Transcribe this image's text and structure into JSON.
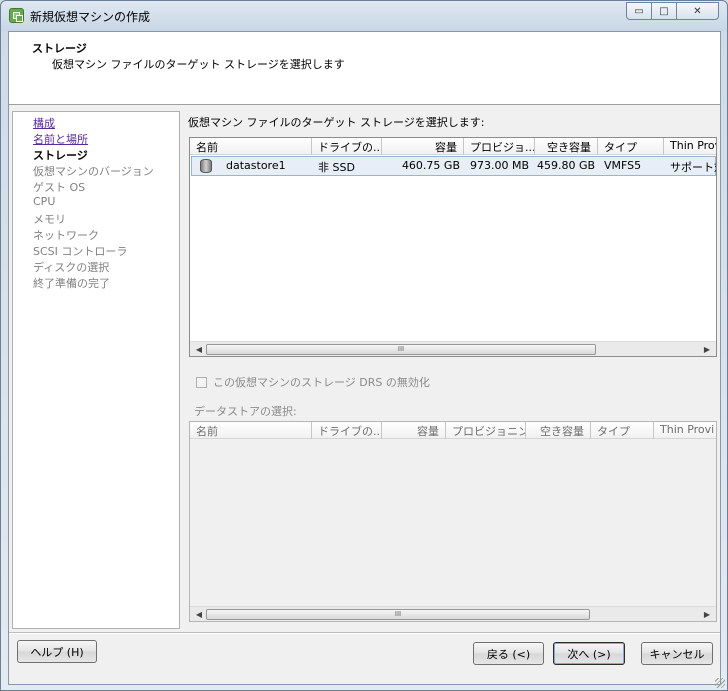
{
  "window": {
    "title": "新規仮想マシンの作成",
    "controls": {
      "minimize_glyph": "▭",
      "maximize_glyph": "□",
      "close_glyph": "✕"
    }
  },
  "header": {
    "title": "ストレージ",
    "subtitle": "仮想マシン ファイルのターゲット ストレージを選択します"
  },
  "nav": {
    "items": [
      {
        "label": "構成",
        "state": "link"
      },
      {
        "label": "名前と場所",
        "state": "link"
      },
      {
        "label": "ストレージ",
        "state": "current"
      },
      {
        "label": "仮想マシンのバージョン",
        "state": "disabled"
      },
      {
        "label": "ゲスト OS",
        "state": "disabled"
      },
      {
        "label": "CPU",
        "state": "disabled"
      },
      {
        "label": "メモリ",
        "state": "disabled"
      },
      {
        "label": "ネットワーク",
        "state": "disabled"
      },
      {
        "label": "SCSI コントローラ",
        "state": "disabled"
      },
      {
        "label": "ディスクの選択",
        "state": "disabled"
      },
      {
        "label": "終了準備の完了",
        "state": "disabled"
      }
    ]
  },
  "content": {
    "prompt": "仮想マシン ファイルのターゲット ストレージを選択します:",
    "datastore_table": {
      "columns": [
        "名前",
        "ドライブの...",
        "容量",
        "プロビジョ...",
        "空き容量",
        "タイプ",
        "Thin Prov"
      ],
      "rows": [
        {
          "icon": "datastore-icon",
          "name": "datastore1",
          "drive": "非 SSD",
          "capacity": "460.75 GB",
          "provisioned": "973.00 MB",
          "free": "459.80 GB",
          "type": "VMFS5",
          "thin": "サポート対"
        }
      ],
      "scroll_grip": "III"
    },
    "drs_checkbox": {
      "label": "この仮想マシンのストレージ DRS の無効化",
      "checked": false
    },
    "select_label": "データストアの選択:",
    "select_table": {
      "columns": [
        "名前",
        "ドライブの...",
        "容量",
        "プロビジョニン...",
        "空き容量",
        "タイプ",
        "Thin Provi"
      ],
      "scroll_grip": "III"
    }
  },
  "footer": {
    "help": "ヘルプ (H)",
    "back": "戻る (<)",
    "next": "次へ (>)",
    "cancel": "キャンセル"
  },
  "scroll_arrows": {
    "left": "◀",
    "right": "▶"
  }
}
